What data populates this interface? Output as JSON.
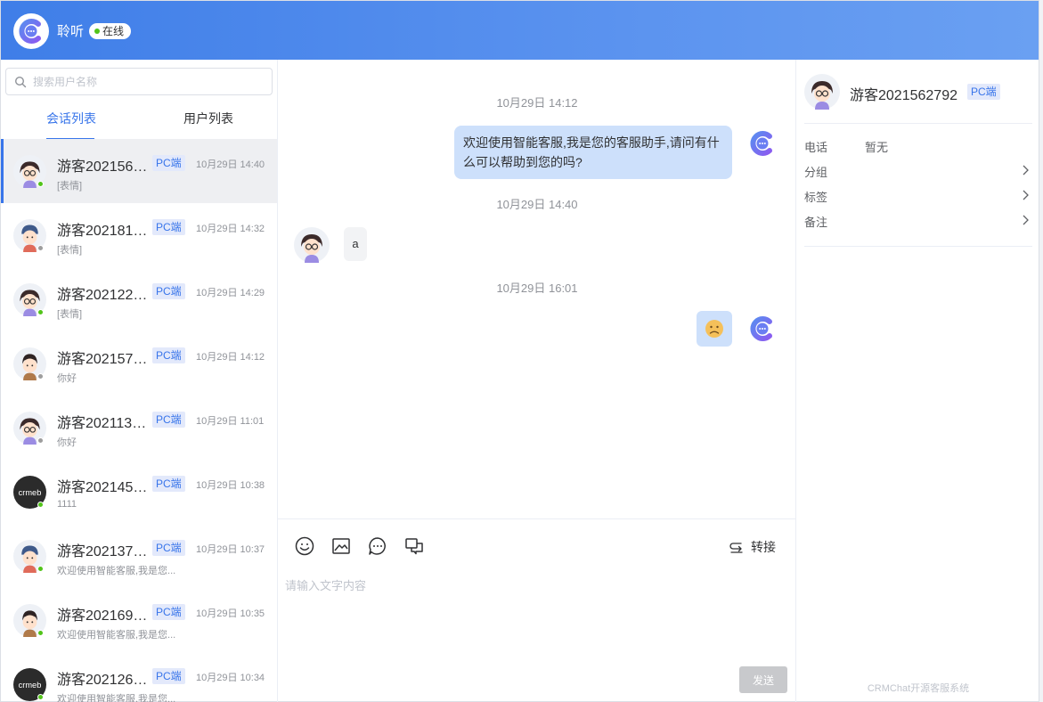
{
  "header": {
    "agent_name": "聆听",
    "status": "在线",
    "status_color": "#52c41a"
  },
  "search": {
    "placeholder": "搜索用户名称",
    "value": ""
  },
  "tabs": [
    {
      "label": "会话列表",
      "active": true
    },
    {
      "label": "用户列表",
      "active": false
    }
  ],
  "conversations": [
    {
      "name": "游客202156…",
      "tag": "PC端",
      "time": "10月29日 14:40",
      "preview": "[表情]",
      "avatar": "girl-glasses",
      "online": true,
      "active": true
    },
    {
      "name": "游客202181…",
      "tag": "PC端",
      "time": "10月29日 14:32",
      "preview": "[表情]",
      "avatar": "boy-cap",
      "online": false,
      "active": false
    },
    {
      "name": "游客202122…",
      "tag": "PC端",
      "time": "10月29日 14:29",
      "preview": "[表情]",
      "avatar": "girl-glasses",
      "online": true,
      "active": false
    },
    {
      "name": "游客202157…",
      "tag": "PC端",
      "time": "10月29日 14:12",
      "preview": "你好",
      "avatar": "boy",
      "online": false,
      "active": false
    },
    {
      "name": "游客202113…",
      "tag": "PC端",
      "time": "10月29日 11:01",
      "preview": "你好",
      "avatar": "girl-glasses",
      "online": false,
      "active": false
    },
    {
      "name": "游客202145…",
      "tag": "PC端",
      "time": "10月29日 10:38",
      "preview": "1111",
      "avatar": "crmeb-logo",
      "online": true,
      "active": false
    },
    {
      "name": "游客202137…",
      "tag": "PC端",
      "time": "10月29日 10:37",
      "preview": "欢迎使用智能客服,我是您...",
      "avatar": "boy-cap",
      "online": true,
      "active": false
    },
    {
      "name": "游客202169…",
      "tag": "PC端",
      "time": "10月29日 10:35",
      "preview": "欢迎使用智能客服,我是您...",
      "avatar": "boy",
      "online": true,
      "active": false
    },
    {
      "name": "游客202126…",
      "tag": "PC端",
      "time": "10月29日 10:34",
      "preview": "欢迎使用智能客服,我是您...",
      "avatar": "crmeb-logo",
      "online": true,
      "active": false
    }
  ],
  "chat": {
    "messages": [
      {
        "type": "timestamp",
        "text": "10月29日 14:12"
      },
      {
        "type": "agent-text",
        "text": "欢迎使用智能客服,我是您的客服助手,请问有什么可以帮助到您的吗?"
      },
      {
        "type": "timestamp",
        "text": "10月29日 14:40"
      },
      {
        "type": "user-text",
        "text": "a"
      },
      {
        "type": "timestamp",
        "text": "10月29日 16:01"
      },
      {
        "type": "agent-emoji",
        "emoji": "frowning-face"
      }
    ],
    "composer": {
      "placeholder": "请输入文字内容",
      "value": "",
      "tools": [
        "emoji-icon",
        "image-icon",
        "quick-reply-icon",
        "chat-record-icon"
      ],
      "transfer_label": "转接",
      "send_label": "发送"
    }
  },
  "user_panel": {
    "name": "游客2021562792",
    "tag": "PC端",
    "phone_label": "电话",
    "phone_value": "暂无",
    "group_label": "分组",
    "tags_label": "标签",
    "remark_label": "备注"
  },
  "footer": {
    "brand": "CRMChat开源客服系统"
  },
  "colors": {
    "accent": "#3875ea",
    "header_start": "#3f7ee8",
    "bubble": "#cde0fb",
    "online": "#52c41a",
    "offline": "#9e9e9e"
  }
}
